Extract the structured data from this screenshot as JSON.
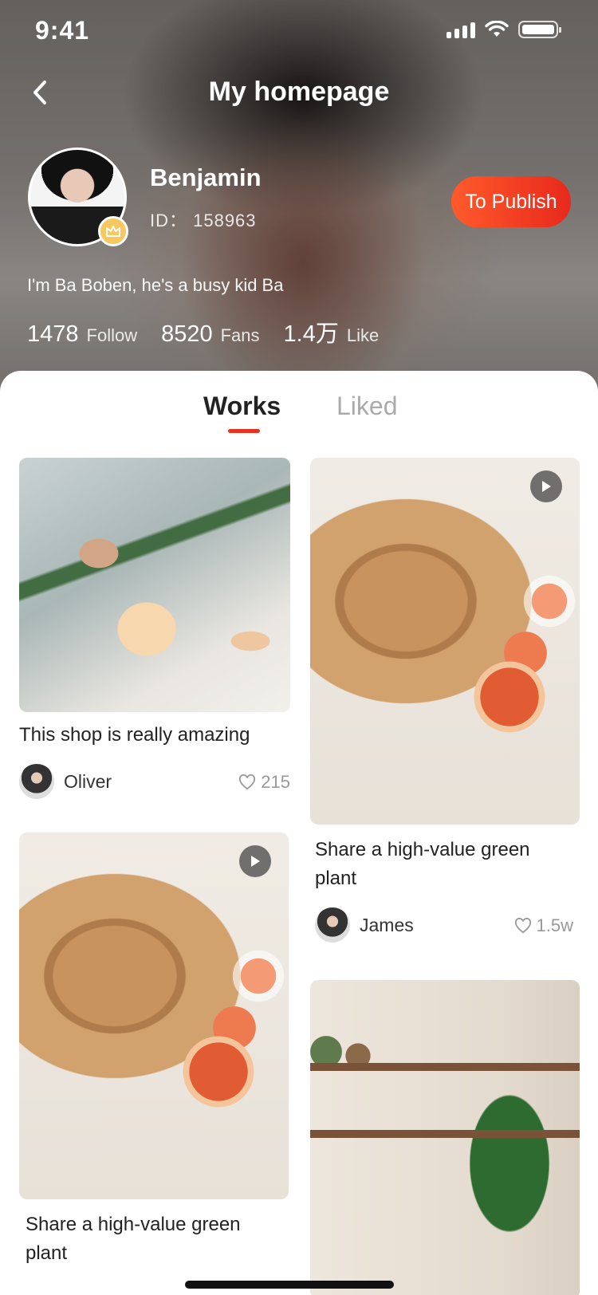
{
  "status_bar": {
    "time": "9:41"
  },
  "nav": {
    "title": "My homepage"
  },
  "profile": {
    "name": "Benjamin",
    "id_text": "ID： 158963",
    "publish_label": "To Publish",
    "bio": "I'm Ba Boben, he's a busy kid Ba",
    "stats": [
      {
        "value": "1478",
        "label": "Follow"
      },
      {
        "value": "8520",
        "label": "Fans"
      },
      {
        "value": "1.4万",
        "label": "Like"
      }
    ]
  },
  "tabs": [
    {
      "label": "Works",
      "active": true
    },
    {
      "label": "Liked",
      "active": false
    }
  ],
  "cards": [
    {
      "title": "This shop is really amazing",
      "author": "Oliver",
      "likes": "215",
      "video": false
    },
    {
      "title": "Share a high-value green plant",
      "author": "James",
      "likes": "1.5w",
      "video": true
    },
    {
      "title": "Share a high-value green plant",
      "author": "",
      "likes": "",
      "video": true
    },
    {
      "title": "",
      "author": "",
      "likes": "",
      "video": false
    }
  ],
  "colors": {
    "accent": "#e8321f",
    "publish_gradient_start": "#ff5a2b",
    "publish_gradient_end": "#e8291c"
  },
  "icons": [
    "back-chevron-icon",
    "signal-icon",
    "wifi-icon",
    "battery-icon",
    "crown-icon",
    "play-icon",
    "heart-icon"
  ]
}
